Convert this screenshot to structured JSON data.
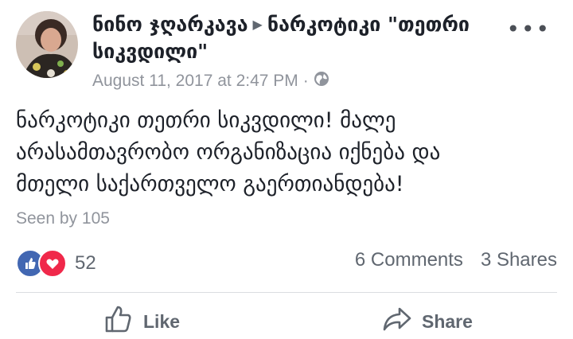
{
  "post": {
    "author": "ნინო ჯღარკავა",
    "target": "ნარკოტიკი \"თეთრი სიკვდილი\"",
    "timestamp": "August 11, 2017 at 2:47 PM",
    "separator": "·",
    "privacy_icon": "globe-icon",
    "text": "ნარკოტიკი თეთრი სიკვდილი! მალე\nარასამთავრობო ორგანიზაცია იქნება და\nმთელი საქართველო გაერთიანდება!",
    "seen_by": "Seen by 105"
  },
  "reactions": {
    "icons": [
      "like-reaction-icon",
      "love-reaction-icon"
    ],
    "count": "52",
    "comments": "6 Comments",
    "shares": "3 Shares"
  },
  "actions": {
    "like_label": "Like",
    "share_label": "Share"
  },
  "colors": {
    "brand_blue": "#4267b2",
    "love_red": "#f0284a",
    "meta_gray": "#90949c"
  }
}
